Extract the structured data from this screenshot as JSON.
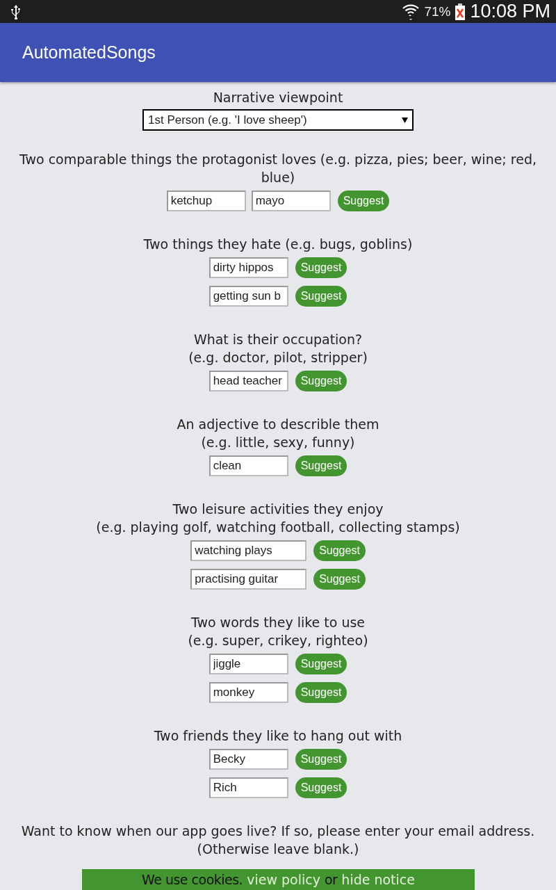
{
  "status_bar": {
    "battery": "71%",
    "time": "10:08 PM"
  },
  "app_bar": {
    "title": "AutomatedSongs"
  },
  "viewpoint": {
    "label": "Narrative viewpoint",
    "value": "1st Person (e.g. 'I love sheep')"
  },
  "sections": [
    {
      "lines": [
        "Two comparable things the protagonist loves (e.g. pizza, pies; beer, wine; red, blue)"
      ],
      "kind": "normal",
      "rows": [
        {
          "values": [
            "ketchup",
            "mayo"
          ],
          "button": "Suggest"
        }
      ]
    },
    {
      "lines": [
        "Two things they hate (e.g. bugs, goblins)"
      ],
      "kind": "normal",
      "rows": [
        {
          "values": [
            "dirty hippos"
          ],
          "button": "Suggest"
        },
        {
          "values": [
            "getting sun b"
          ],
          "button": "Suggest"
        }
      ]
    },
    {
      "lines": [
        "What is their occupation?",
        "(e.g. doctor, pilot, stripper)"
      ],
      "kind": "normal",
      "rows": [
        {
          "values": [
            "head teacher"
          ],
          "button": "Suggest"
        }
      ]
    },
    {
      "lines": [
        "An adjective to describle them",
        "(e.g. little, sexy, funny)"
      ],
      "kind": "normal",
      "rows": [
        {
          "values": [
            "clean"
          ],
          "button": "Suggest"
        }
      ]
    },
    {
      "lines": [
        "Two leisure activities they enjoy",
        "(e.g. playing golf, watching football, collecting stamps)"
      ],
      "kind": "wide",
      "rows": [
        {
          "values": [
            "watching plays"
          ],
          "button": "Suggest"
        },
        {
          "values": [
            "practising guitar"
          ],
          "button": "Suggest"
        }
      ]
    },
    {
      "lines": [
        "Two words they like to use",
        "(e.g. super, crikey, righteo)"
      ],
      "kind": "normal",
      "rows": [
        {
          "values": [
            "jiggle"
          ],
          "button": "Suggest"
        },
        {
          "values": [
            "monkey"
          ],
          "button": "Suggest"
        }
      ]
    },
    {
      "lines": [
        "Two friends they like to hang out with"
      ],
      "kind": "normal",
      "rows": [
        {
          "values": [
            "Becky"
          ],
          "button": "Suggest"
        },
        {
          "values": [
            "Rich"
          ],
          "button": "Suggest"
        }
      ]
    }
  ],
  "email_prompt": [
    "Want to know when our app goes live? If so, please enter your email address.",
    "(Otherwise leave blank.)"
  ],
  "cookie_notice": {
    "text": "We use cookies.",
    "policy_link": "view policy",
    "separator": "or",
    "hide_link": "hide notice"
  }
}
